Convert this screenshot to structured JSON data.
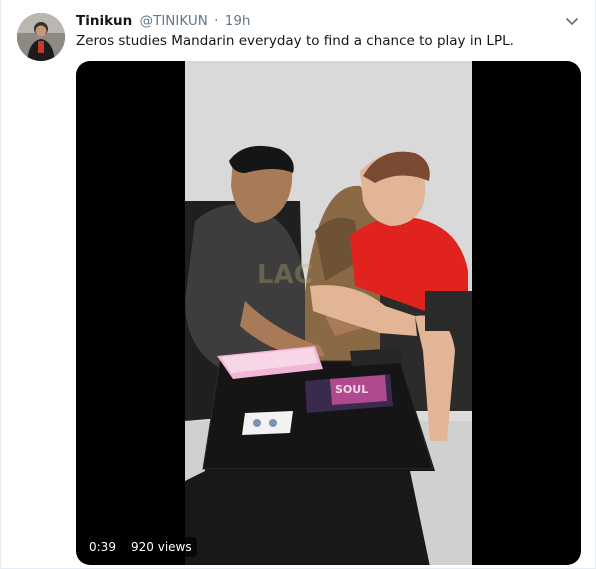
{
  "tweet": {
    "author_name": "Tinikun",
    "handle": "@TINIKUN",
    "separator": "·",
    "timestamp": "19h",
    "text": "Zeros studies Mandarin everyday to find a chance to play in LPL.",
    "menu_icon": "chevron-down-icon",
    "avatar_icon": "profile-photo"
  },
  "video": {
    "duration": "0:39",
    "views": "920 views",
    "book_title": "SOUL",
    "watermark": "LAC"
  },
  "colors": {
    "text_primary": "#14171a",
    "text_secondary": "#657786",
    "video_background": "#000000",
    "shirt_red": "#e0231f",
    "shirt_dark": "#3c3c3c"
  }
}
